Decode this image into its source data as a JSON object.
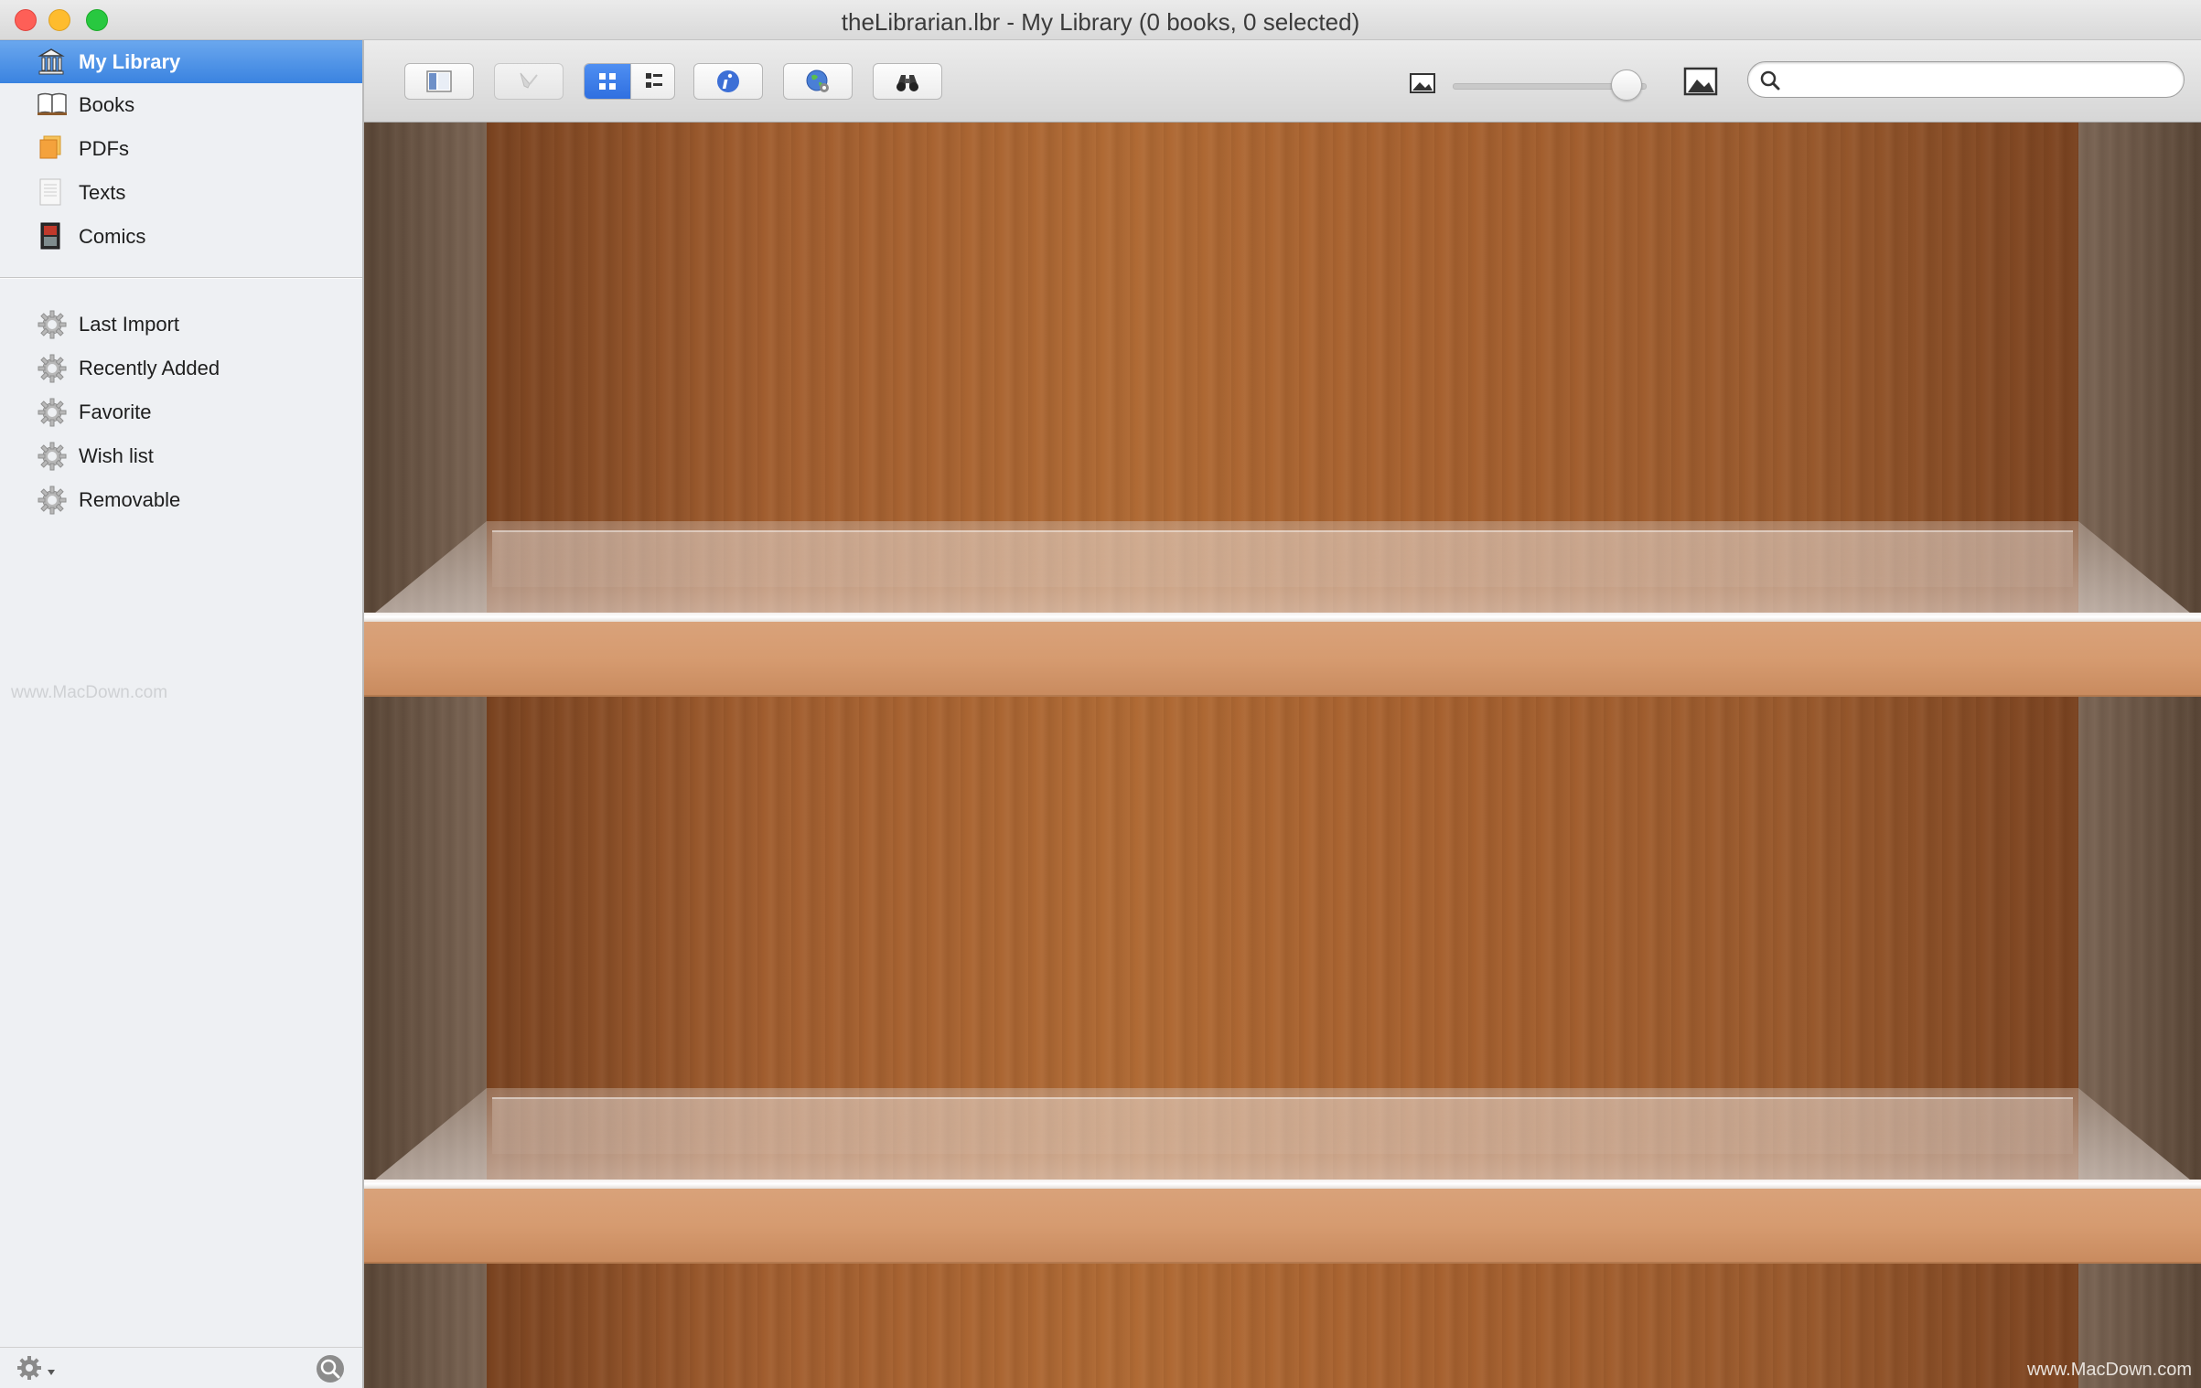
{
  "window": {
    "title": "theLibrarian.lbr - My Library (0 books, 0 selected)"
  },
  "sidebar": {
    "library_items": [
      {
        "label": "My Library",
        "icon": "library-icon",
        "selected": true
      },
      {
        "label": "Books",
        "icon": "book-icon",
        "selected": false
      },
      {
        "label": "PDFs",
        "icon": "pdf-icon",
        "selected": false
      },
      {
        "label": "Texts",
        "icon": "text-document-icon",
        "selected": false
      },
      {
        "label": "Comics",
        "icon": "comic-icon",
        "selected": false
      }
    ],
    "smart_items": [
      {
        "label": "Last Import",
        "icon": "gear-icon"
      },
      {
        "label": "Recently Added",
        "icon": "gear-icon"
      },
      {
        "label": "Favorite",
        "icon": "gear-icon"
      },
      {
        "label": "Wish list",
        "icon": "gear-icon"
      },
      {
        "label": "Removable",
        "icon": "gear-icon"
      }
    ],
    "watermark": "www.MacDown.com"
  },
  "toolbar": {
    "view_mode": "grid",
    "cover_size_level": 0.9,
    "search_placeholder": "",
    "search_value": ""
  },
  "content": {
    "watermark": "www.MacDown.com"
  },
  "colors": {
    "selection": "#3a83e0",
    "wood_back": "#a5602f",
    "shelf_front": "#d69b70"
  }
}
